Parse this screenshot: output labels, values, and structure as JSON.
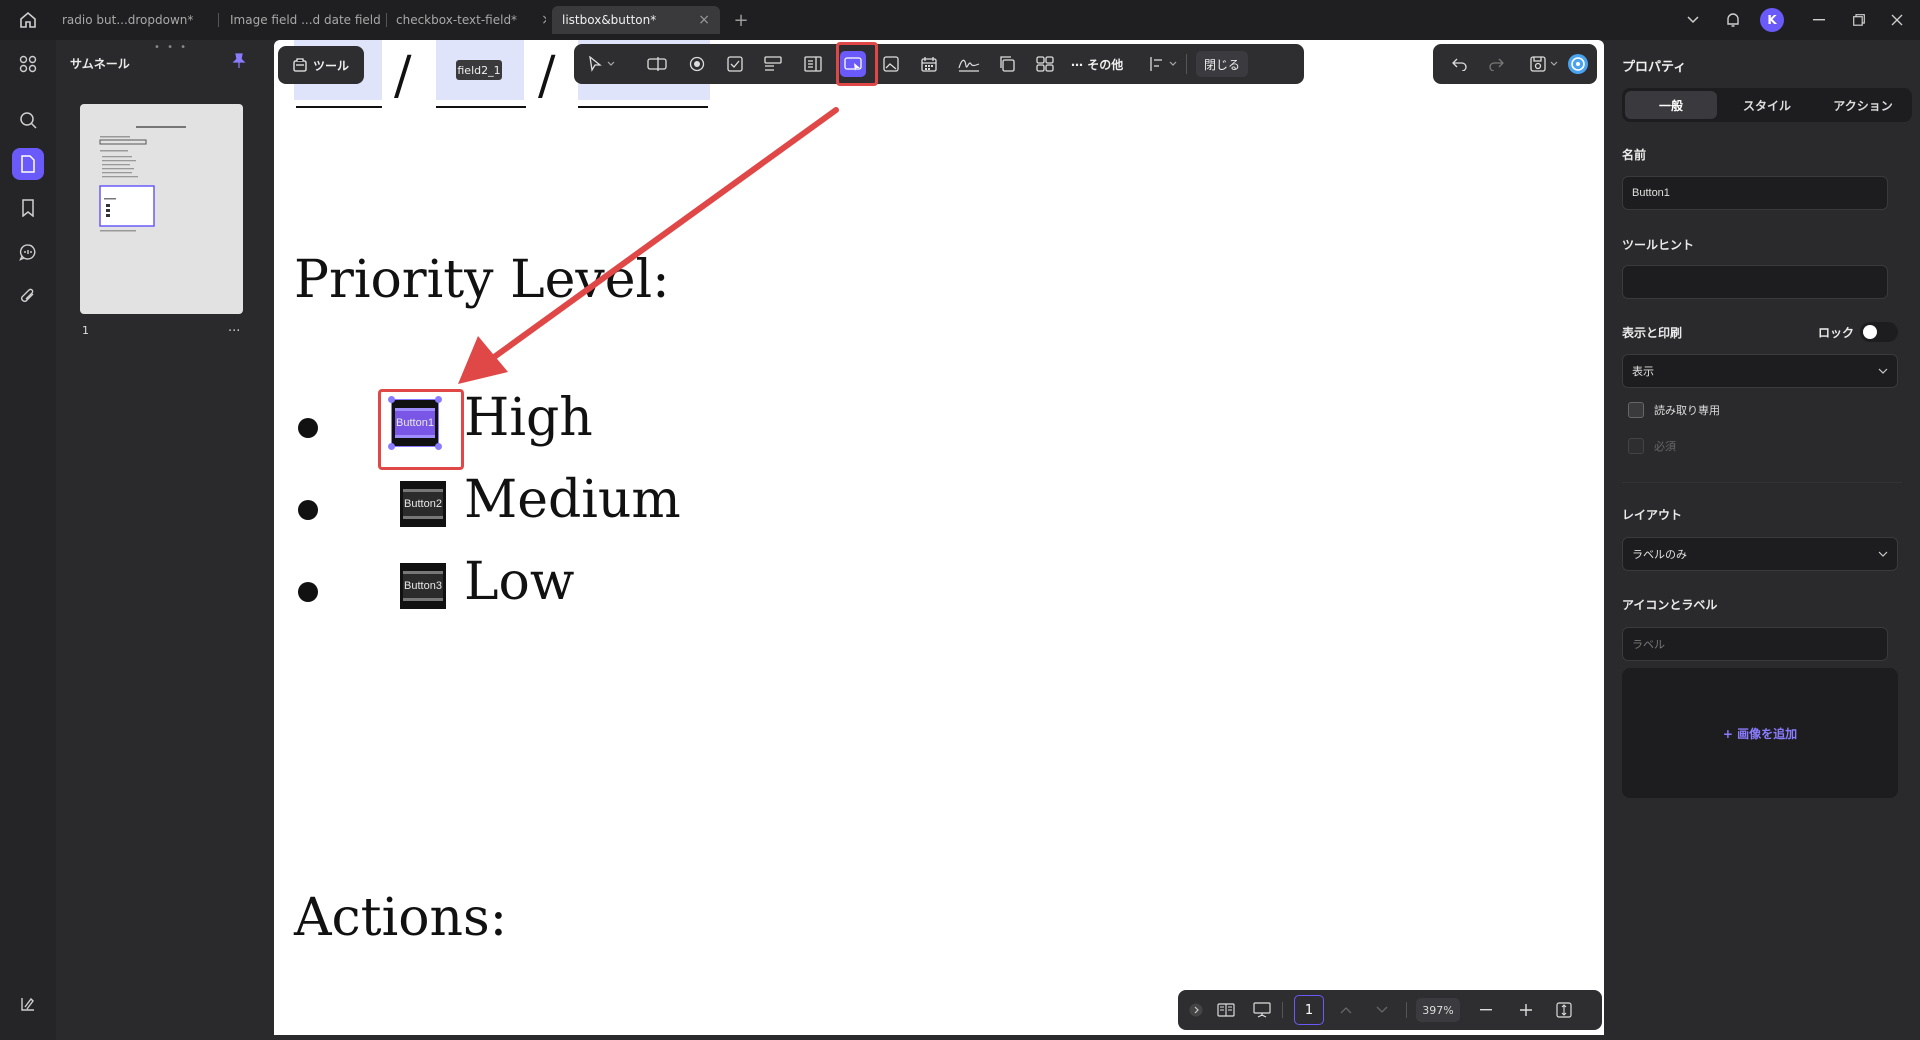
{
  "window": {
    "tabs": [
      {
        "label": "radio but...dropdown*",
        "active": false
      },
      {
        "label": "Image field ...d date field",
        "active": false
      },
      {
        "label": "checkbox-text-field*",
        "active": false
      },
      {
        "label": "listbox&button*",
        "active": true
      }
    ],
    "new_tab": "+",
    "avatar_initial": "K"
  },
  "thumbnails": {
    "title": "サムネール",
    "page_number": "1",
    "more": "..."
  },
  "toolbar": {
    "tool_label": "ツール",
    "more_label": "その他",
    "close_label": "閉じる"
  },
  "document": {
    "field_label": "field2_1",
    "slash": "/",
    "heading": "Priority Level:",
    "options": [
      {
        "text": "High",
        "button": "Button1",
        "selected": true
      },
      {
        "text": "Medium",
        "button": "Button2",
        "selected": false
      },
      {
        "text": "Low",
        "button": "Button3",
        "selected": false
      }
    ],
    "actions_heading": "Actions:"
  },
  "bottom_bar": {
    "page": "1",
    "zoom": "397%"
  },
  "properties": {
    "title": "プロパティ",
    "tabs": [
      "一般",
      "スタイル",
      "アクション"
    ],
    "active_tab": "一般",
    "name_label": "名前",
    "name_value": "Button1",
    "tooltip_label": "ツールヒント",
    "tooltip_value": "",
    "display_label": "表示と印刷",
    "lock_label": "ロック",
    "display_value": "表示",
    "readonly_label": "読み取り専用",
    "required_label": "必須",
    "layout_label": "レイアウト",
    "layout_value": "ラベルのみ",
    "icon_label_label": "アイコンとラベル",
    "label_placeholder": "ラベル",
    "add_image": "+ 画像を追加"
  },
  "colors": {
    "accent": "#6a5af9",
    "annotation_red": "#e04848"
  }
}
